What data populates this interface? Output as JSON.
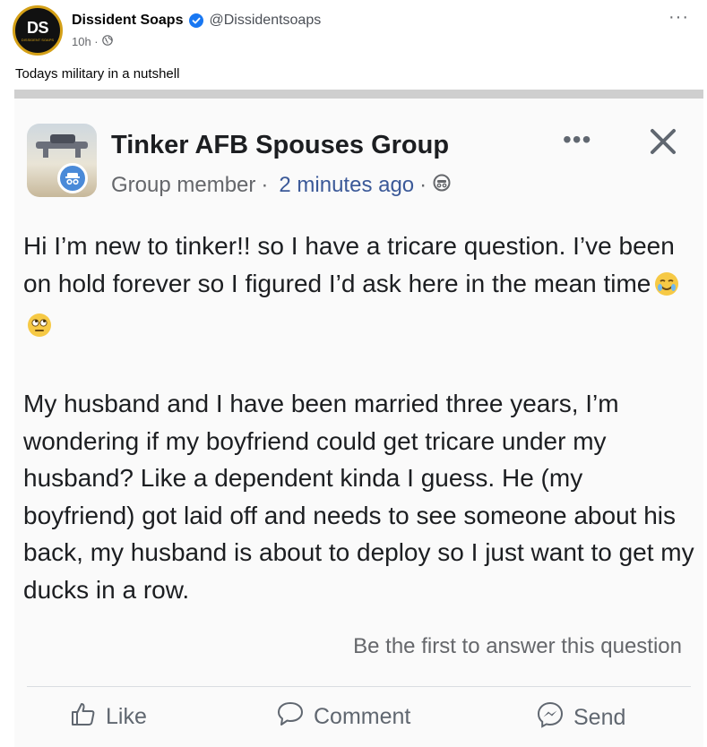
{
  "post": {
    "author": "Dissident Soaps",
    "handle": "@Dissidentsoaps",
    "time": "10h ·",
    "caption": "Todays military in a nutshell",
    "avatar_initials": "DS",
    "avatar_subtext": "DISSIDENT SOAPS"
  },
  "screenshot": {
    "group_name": "Tinker AFB Spouses Group",
    "member_label": "Group member",
    "time": "2 minutes ago",
    "paragraph1": "Hi I’m new to tinker!! so I have a tricare question. I’ve been on hold forever so I figured I’d ask here in the mean time",
    "paragraph2": "My husband and I have been married three years, I’m wondering if my boyfriend could get tricare under my husband? Like a dependent kinda I guess. He (my boyfriend) got laid off and needs to see someone about his back, my husband is about to deploy so I just want to get my ducks in a row.",
    "cta": "Be the first to answer this question",
    "actions": {
      "like": "Like",
      "comment": "Comment",
      "send": "Send"
    }
  },
  "icons": [
    "verified-badge-icon",
    "globe-icon",
    "more-icon",
    "close-icon",
    "anonymous-member-icon",
    "privacy-icon",
    "like-icon",
    "comment-icon",
    "messenger-icon",
    "crying-smile-emoji",
    "eye-roll-emoji"
  ],
  "colors": {
    "verified": "#1877f2",
    "link_time": "#3b5998",
    "muted": "#65676b",
    "avatar_ring": "#d4a017"
  }
}
